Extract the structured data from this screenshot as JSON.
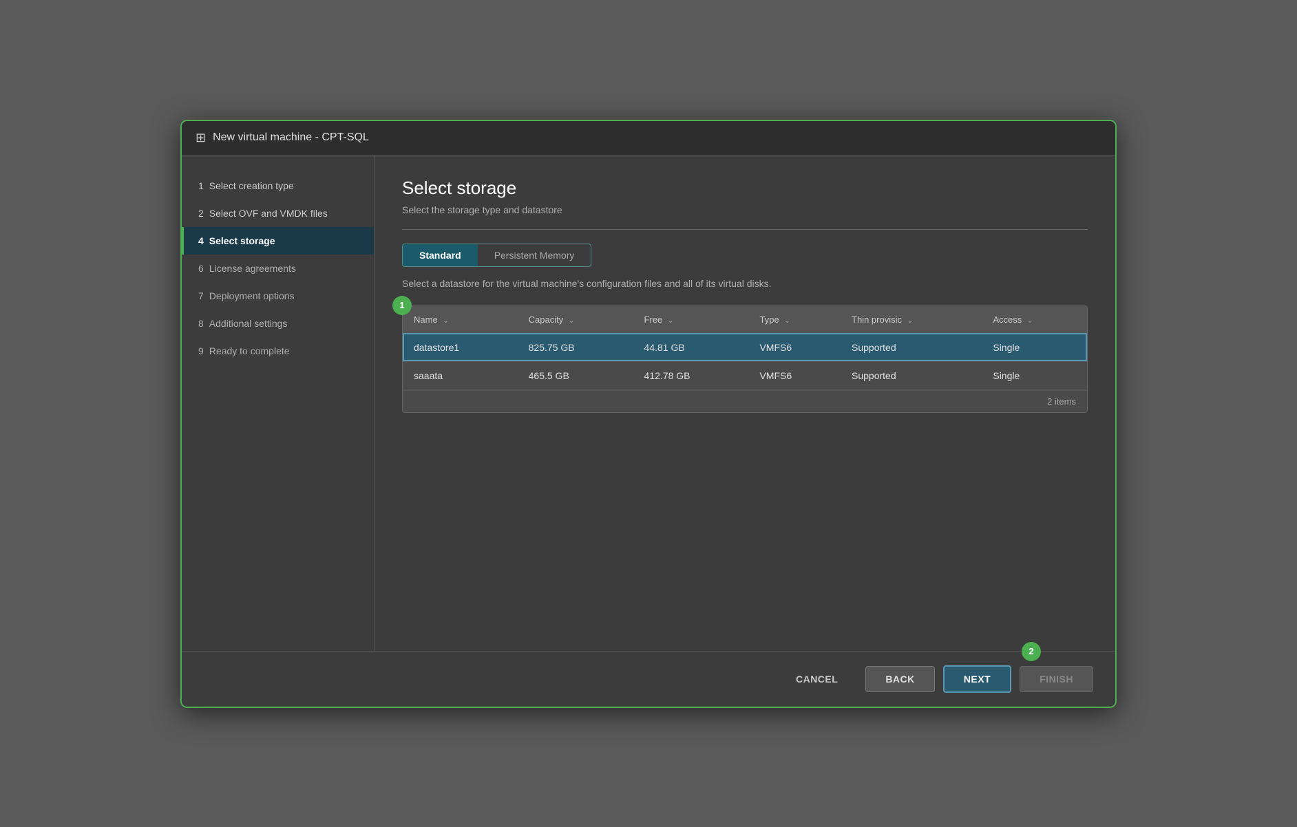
{
  "window": {
    "title": "New virtual machine - CPT-SQL",
    "icon": "⊞"
  },
  "sidebar": {
    "items": [
      {
        "id": "step1",
        "number": "1",
        "label": "Select creation type",
        "state": "completed"
      },
      {
        "id": "step2",
        "number": "2",
        "label": "Select OVF and VMDK files",
        "state": "completed"
      },
      {
        "id": "step4",
        "number": "4",
        "label": "Select storage",
        "state": "active"
      },
      {
        "id": "step6",
        "number": "6",
        "label": "License agreements",
        "state": "normal"
      },
      {
        "id": "step7",
        "number": "7",
        "label": "Deployment options",
        "state": "normal"
      },
      {
        "id": "step8",
        "number": "8",
        "label": "Additional settings",
        "state": "normal"
      },
      {
        "id": "step9",
        "number": "9",
        "label": "Ready to complete",
        "state": "normal"
      }
    ]
  },
  "main": {
    "title": "Select storage",
    "subtitle": "Select the storage type and datastore",
    "divider": true,
    "tabs": [
      {
        "id": "standard",
        "label": "Standard",
        "active": true
      },
      {
        "id": "persistent",
        "label": "Persistent Memory",
        "active": false
      }
    ],
    "tab_description": "Select a datastore for the virtual machine's configuration files and all of its virtual disks.",
    "badge1": "1",
    "table": {
      "columns": [
        {
          "id": "name",
          "label": "Name",
          "sortable": true
        },
        {
          "id": "capacity",
          "label": "Capacity",
          "sortable": true
        },
        {
          "id": "free",
          "label": "Free",
          "sortable": true
        },
        {
          "id": "type",
          "label": "Type",
          "sortable": true
        },
        {
          "id": "thin",
          "label": "Thin provisic",
          "sortable": true
        },
        {
          "id": "access",
          "label": "Access",
          "sortable": true
        }
      ],
      "rows": [
        {
          "name": "datastore1",
          "capacity": "825.75 GB",
          "free": "44.81 GB",
          "type": "VMFS6",
          "thin": "Supported",
          "access": "Single",
          "selected": true
        },
        {
          "name": "saaata",
          "capacity": "465.5 GB",
          "free": "412.78 GB",
          "type": "VMFS6",
          "thin": "Supported",
          "access": "Single",
          "selected": false
        }
      ],
      "items_count": "2 items"
    }
  },
  "footer": {
    "badge2": "2",
    "cancel_label": "CANCEL",
    "back_label": "BACK",
    "next_label": "NEXT",
    "finish_label": "FINISH"
  }
}
